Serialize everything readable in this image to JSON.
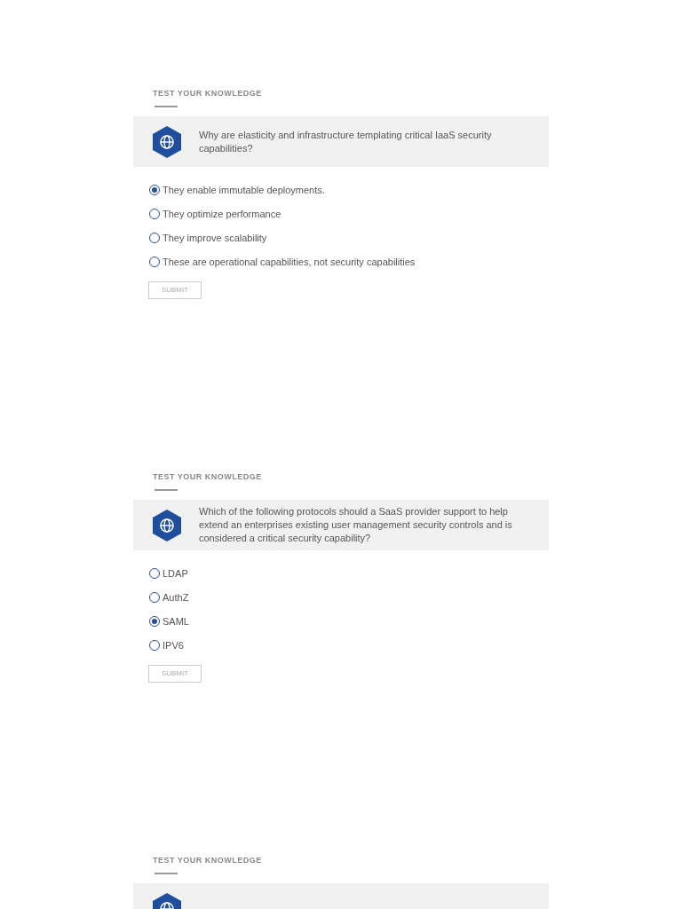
{
  "quizzes": [
    {
      "heading": "TEST YOUR KNOWLEDGE",
      "question": "Why are elasticity and infrastructure templating critical IaaS security capabilities?",
      "options": [
        {
          "label": "They enable immutable deployments.",
          "selected": true
        },
        {
          "label": "They optimize performance",
          "selected": false
        },
        {
          "label": "They improve scalability",
          "selected": false
        },
        {
          "label": "These are operational capabilities, not security capabilities",
          "selected": false
        }
      ],
      "submit": "SUBMIT"
    },
    {
      "heading": "TEST YOUR KNOWLEDGE",
      "question": "Which of the following protocols should a SaaS provider support to help extend an enterprises existing user management security controls and is considered a critical security capability?",
      "options": [
        {
          "label": "LDAP",
          "selected": false
        },
        {
          "label": "AuthZ",
          "selected": false
        },
        {
          "label": "SAML",
          "selected": true
        },
        {
          "label": "IPV6",
          "selected": false
        }
      ],
      "submit": "SUBMIT"
    },
    {
      "heading": "TEST YOUR KNOWLEDGE"
    }
  ]
}
